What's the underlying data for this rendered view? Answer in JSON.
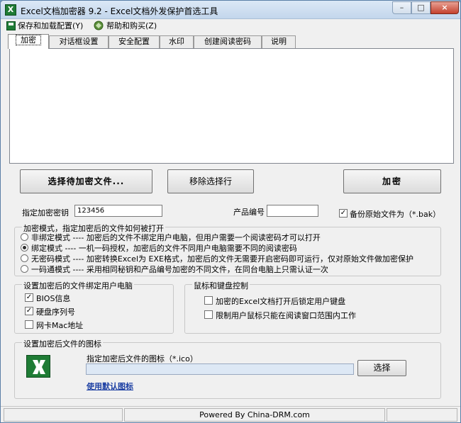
{
  "window": {
    "title": "Excel文档加密器 9.2 - Excel文档外发保护首选工具"
  },
  "menu": {
    "items": [
      "保存和加载配置(Y)",
      "帮助和购买(Z)"
    ]
  },
  "tabs": [
    "加密",
    "对话框设置",
    "安全配置",
    "水印",
    "创建阅读密码",
    "说明"
  ],
  "buttons": {
    "select_files": "选择待加密文件...",
    "remove_selection": "移除选择行",
    "encrypt": "加密",
    "choose_icon": "选择"
  },
  "key": {
    "label": "指定加密密钥",
    "value": "123456"
  },
  "product": {
    "label": "产品编号",
    "value": ""
  },
  "backup": {
    "label": "备份原始文件为（*.bak）",
    "checked": true
  },
  "encryption_mode": {
    "title": "加密模式，指定加密后的文件如何被打开",
    "options": [
      {
        "label": "非绑定模式 ---- 加密后的文件不绑定用户电脑，但用户需要一个阅读密码才可以打开",
        "checked": false
      },
      {
        "label": "绑定模式 ---- 一机一码授权，加密后的文件不同用户电脑需要不同的阅读密码",
        "checked": true
      },
      {
        "label": "无密码模式 ---- 加密转换Excel为 EXE格式，加密后的文件无需要开启密码即可运行，仅对原始文件做加密保护",
        "checked": false
      },
      {
        "label": "一码通模式 ---- 采用相同秘钥和产品编号加密的不同文件，在同台电脑上只需认证一次",
        "checked": false
      }
    ]
  },
  "bind_pc": {
    "title": "设置加密后的文件绑定用户电脑",
    "options": [
      {
        "label": "BIOS信息",
        "checked": true
      },
      {
        "label": "硬盘序列号",
        "checked": true
      },
      {
        "label": "网卡Mac地址",
        "checked": false
      }
    ]
  },
  "mouse_keyboard": {
    "title": "鼠标和键盘控制",
    "options": [
      {
        "label": "加密的Excel文档打开后锁定用户键盘",
        "checked": false
      },
      {
        "label": "限制用户鼠标只能在阅读窗口范围内工作",
        "checked": false
      }
    ]
  },
  "icon_group": {
    "title": "设置加密后文件的图标",
    "field_label": "指定加密后文件的图标（*.ico）",
    "field_value": "",
    "default_link": "使用默认图标"
  },
  "status": {
    "text": "Powered By China-DRM.com"
  },
  "colors": {
    "link": "#1c3fa3",
    "excel_green": "#1f7c35"
  }
}
